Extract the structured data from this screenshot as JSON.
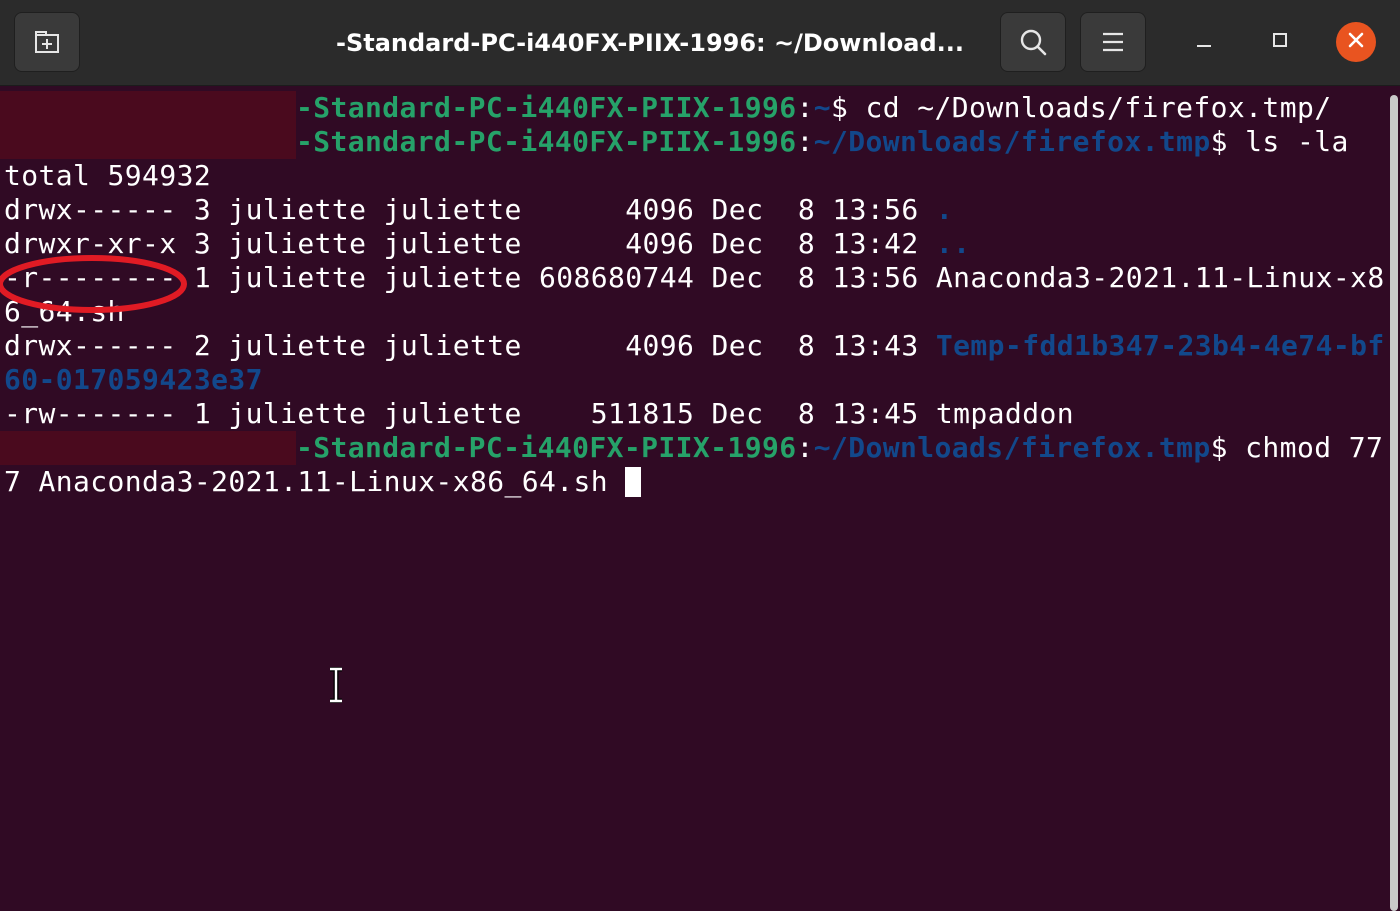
{
  "window": {
    "title": "-Standard-PC-i440FX-PIIX-1996: ~/Download...",
    "colors": {
      "header_bg": "#2b2b2b",
      "terminal_bg": "#300a24",
      "prompt_user": "#26a269",
      "prompt_path": "#12488b",
      "directory": "#12488b",
      "annotation": "#e01b24",
      "close_button": "#e95420"
    },
    "icons": {
      "new_tab": "new-tab-icon",
      "search": "search-icon",
      "menu": "hamburger-menu-icon",
      "minimize": "minimize-icon",
      "maximize": "maximize-icon",
      "close": "close-icon"
    }
  },
  "terminal": {
    "lines": [
      {
        "prompt_host": "-Standard-PC-i440FX-PIIX-1996",
        "prompt_colon": ":",
        "prompt_path": "~",
        "prompt_end": "$ ",
        "command": "cd ~/Downloads/firefox.tmp/"
      },
      {
        "prompt_host": "-Standard-PC-i440FX-PIIX-1996",
        "prompt_colon": ":",
        "prompt_path": "~/Downloads/firefox.tmp",
        "prompt_end": "$ ",
        "command": "ls -la"
      },
      {
        "text": "total 594932"
      },
      {
        "text": "drwx------ 3 juliette juliette      4096 Dec  8 13:56 ",
        "dir": "."
      },
      {
        "text": "drwxr-xr-x 3 juliette juliette      4096 Dec  8 13:42 ",
        "dir": ".."
      },
      {
        "text": "-r-------- 1 juliette juliette 608680744 Dec  8 13:56 Anaconda3-2021.11-Linux-x8"
      },
      {
        "text": "6_64.sh"
      },
      {
        "text": "drwx------ 2 juliette juliette      4096 Dec  8 13:43 ",
        "dir": "Temp-fdd1b347-23b4-4e74-bf"
      },
      {
        "dir": "60-017059423e37"
      },
      {
        "text": "-rw------- 1 juliette juliette    511815 Dec  8 13:45 tmpaddon"
      },
      {
        "prompt_host": "-Standard-PC-i440FX-PIIX-1996",
        "prompt_colon": ":",
        "prompt_path": "~/Downloads/firefox.tmp",
        "prompt_end": "$ ",
        "command": "chmod 77"
      },
      {
        "text": "7 Anaconda3-2021.11-Linux-x86_64.sh "
      }
    ]
  }
}
